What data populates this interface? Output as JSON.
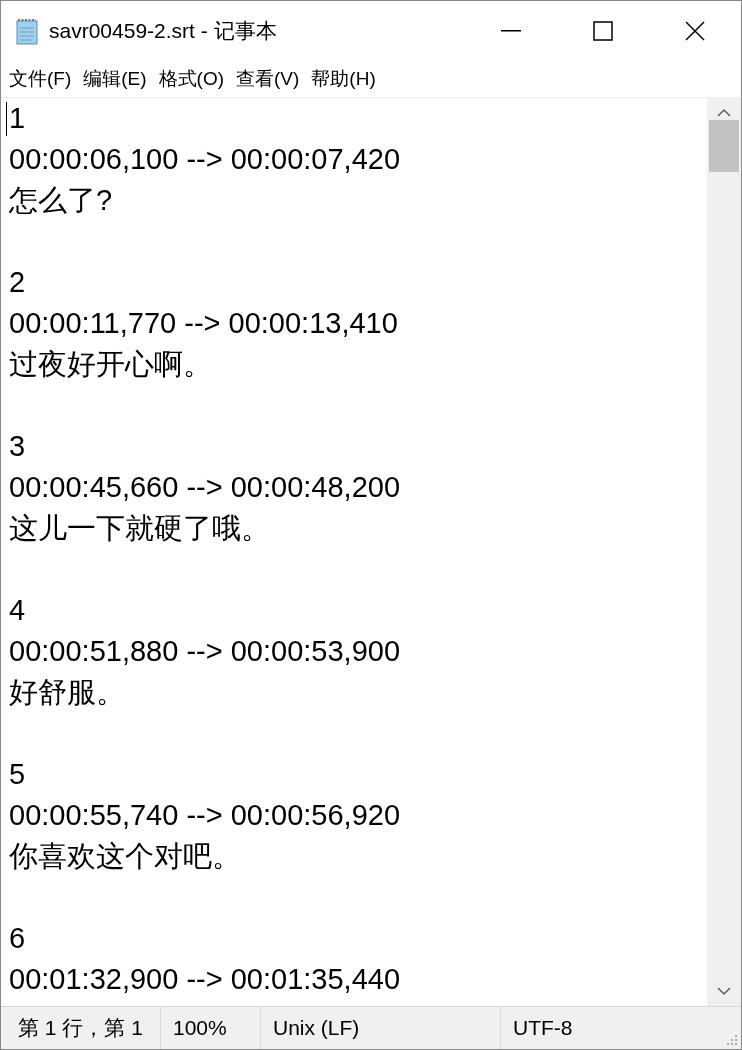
{
  "window": {
    "title": "savr00459-2.srt - 记事本",
    "controls": [
      {
        "kind": "minimize"
      },
      {
        "kind": "maximize"
      },
      {
        "kind": "close"
      }
    ]
  },
  "menu": [
    "文件(F)",
    "编辑(E)",
    "格式(O)",
    "查看(V)",
    "帮助(H)"
  ],
  "entries": [
    {
      "number": "1",
      "time": "00:00:06,100 --> 00:00:07,420",
      "text": "怎么了?"
    },
    {
      "number": "2",
      "time": "00:00:11,770 --> 00:00:13,410",
      "text": "过夜好开心啊。"
    },
    {
      "number": "3",
      "time": "00:00:45,660 --> 00:00:48,200",
      "text": "这儿一下就硬了哦。"
    },
    {
      "number": "4",
      "time": "00:00:51,880 --> 00:00:53,900",
      "text": "好舒服。"
    },
    {
      "number": "5",
      "time": "00:00:55,740 --> 00:00:56,920",
      "text": "你喜欢这个对吧。"
    },
    {
      "number": "6",
      "time": "00:01:32,900 --> 00:01:35,440"
    }
  ],
  "status_bar": [
    "第 1 行，第 1",
    "100%",
    "Unix (LF)",
    "UTF-8"
  ]
}
